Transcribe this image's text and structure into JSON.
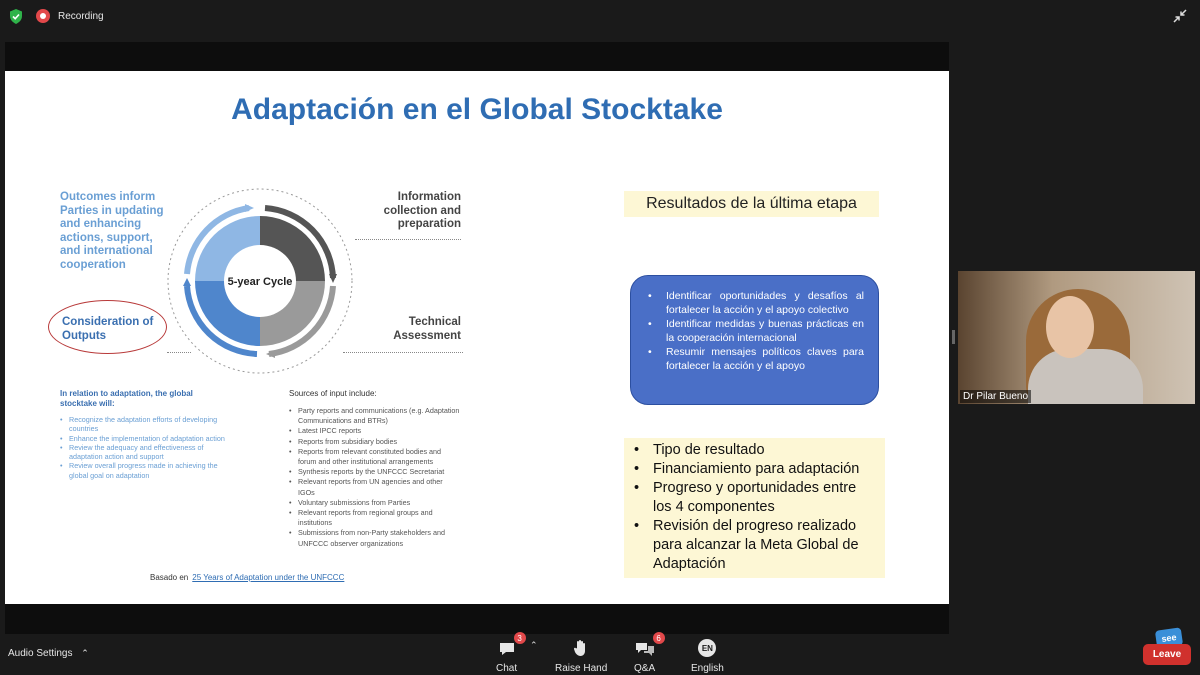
{
  "topbar": {
    "recording_label": "Recording"
  },
  "slide": {
    "title": "Adaptación en el Global Stocktake",
    "cycle": {
      "center_label": "5-year Cycle",
      "top_left": "Outcomes inform Parties in updating and enhancing actions, support, and international cooperation",
      "top_right": "Information collection and preparation",
      "bottom_right": "Technical Assessment",
      "bottom_left": "Consideration of Outputs"
    },
    "adaptation": {
      "heading": "In relation to adaptation, the global stocktake will:",
      "items": [
        "Recognize the adaptation efforts of developing countries",
        "Enhance the implementation of adaptation action",
        "Review the adequacy and effectiveness of adaptation action and support",
        "Review overall progress made in achieving the global goal on adaptation"
      ]
    },
    "sources": {
      "heading": "Sources of input include:",
      "items": [
        "Party reports and communications (e.g. Adaptation Communications and BTRs)",
        "Latest IPCC reports",
        "Reports from subsidiary bodies",
        "Reports from relevant constituted bodies and forum and other institutional arrangements",
        "Synthesis reports by the UNFCCC Secretariat",
        "Relevant reports from UN agencies and other IGOs",
        "Voluntary submissions from Parties",
        "Relevant reports from regional groups and institutions",
        "Submissions from non-Party stakeholders and UNFCCC observer organizations"
      ]
    },
    "based_on": {
      "prefix": "Basado en",
      "link": "25 Years of Adaptation under the UNFCCC"
    },
    "results_title": "Resultados de la última etapa",
    "blue_items": [
      "Identificar oportunidades y desafíos al fortalecer la acción y el apoyo colectivo",
      "Identificar medidas y buenas prácticas en la cooperación internacional",
      "Resumir mensajes políticos claves para fortalecer la acción y el apoyo"
    ],
    "yellow_items": [
      "Tipo de resultado",
      "Financiamiento para adaptación",
      "Progreso y oportunidades entre los 4 componentes",
      "Revisión del progreso realizado para alcanzar la Meta Global de Adaptación"
    ]
  },
  "participant": {
    "name": "Dr Pilar Bueno"
  },
  "toolbar": {
    "audio_settings": "Audio Settings",
    "chat_label": "Chat",
    "chat_badge": "3",
    "raise_hand_label": "Raise Hand",
    "qa_label": "Q&A",
    "qa_badge": "6",
    "english_code": "EN",
    "english_label": "English",
    "leave_label": "Leave",
    "see_logo": "see"
  },
  "colors": {
    "title_blue": "#2f6db3",
    "blue_box": "#4a6fc7",
    "highlight_yellow": "#fdf7d5",
    "leave_red": "#d0312d",
    "badge_red": "#e2484a"
  },
  "icons": [
    "shield-icon",
    "recording-icon",
    "exit-fullscreen-icon",
    "chevron-up-icon",
    "chat-icon",
    "raise-hand-icon",
    "qa-icon",
    "language-icon"
  ]
}
